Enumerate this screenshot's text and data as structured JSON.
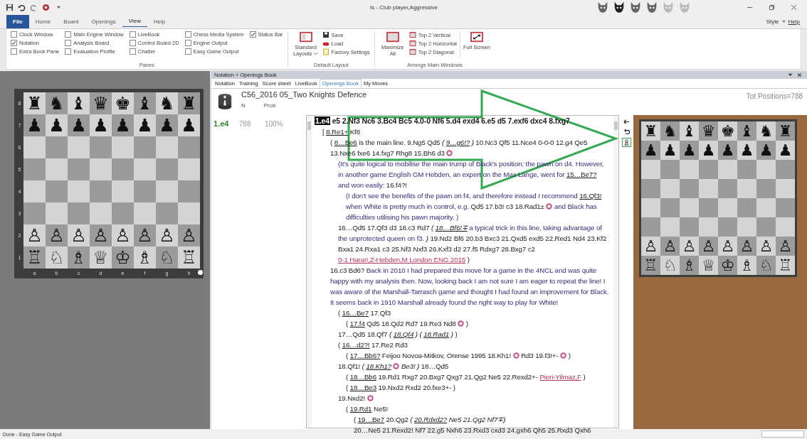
{
  "title_bar": {
    "title": "ts - Club player,Aggressive"
  },
  "ribbon": {
    "tabs": [
      {
        "label": "File",
        "kind": "file",
        "selected": false
      },
      {
        "label": "Home",
        "kind": "tab",
        "selected": false
      },
      {
        "label": "Board",
        "kind": "tab",
        "selected": false
      },
      {
        "label": "Openings",
        "kind": "tab",
        "selected": false
      },
      {
        "label": "View",
        "kind": "tab",
        "selected": true
      },
      {
        "label": "Help",
        "kind": "tab",
        "selected": false
      }
    ],
    "style_menu": "Style",
    "help_link": "Help",
    "panes": {
      "label": "Panes",
      "columns": [
        [
          {
            "label": "Clock Window",
            "checked": false
          },
          {
            "label": "Notation",
            "checked": true
          },
          {
            "label": "Extra Book Pane",
            "checked": false
          }
        ],
        [
          {
            "label": "Main Engine Window",
            "checked": false
          },
          {
            "label": "Analysis Board",
            "checked": false
          },
          {
            "label": "Evaluation Profile",
            "checked": false
          }
        ],
        [
          {
            "label": "LiveBook",
            "checked": false
          },
          {
            "label": "Control Board 2D",
            "checked": false
          },
          {
            "label": "Chatter",
            "checked": false
          }
        ],
        [
          {
            "label": "Chess Media System",
            "checked": false
          },
          {
            "label": "Engine Output",
            "checked": false
          },
          {
            "label": "Easy Game Output",
            "checked": false
          }
        ],
        [
          {
            "label": "Status Bar",
            "checked": true
          }
        ]
      ]
    },
    "default_layout": {
      "label": "Default Layout",
      "standard_layouts": "Standard Layouts",
      "save": "Save",
      "load": "Load",
      "factory_settings": "Factory Settings"
    },
    "arrange": {
      "label": "Arrange Main Windows",
      "maximize": "Maximize All",
      "options": [
        "Top 2 Vertical",
        "Top 2 Horizontal",
        "Top 2 Diagonal"
      ],
      "full_screen": "Full Screen"
    }
  },
  "left_board": {
    "ranks": [
      {
        "label": "8",
        "kind": "pieces",
        "pieces": "♜ ♞ ♝ ♛ ♚ ♝ ♞ ♜"
      },
      {
        "label": "7",
        "kind": "pieces",
        "pieces": "♟ ♟ ♟ ♟ ♟ ♟ ♟ ♟"
      },
      {
        "label": "6",
        "kind": "empty"
      },
      {
        "label": "5",
        "kind": "empty"
      },
      {
        "label": "4",
        "kind": "empty"
      },
      {
        "label": "3",
        "kind": "empty"
      },
      {
        "label": "2",
        "kind": "pieces",
        "pieces": "♙ ♙ ♙ ♙ ♙ ♙ ♙ ♙"
      },
      {
        "label": "1",
        "kind": "pieces",
        "pieces": "♖ ♘ ♗ ♕ ♔ ♗ ♘ ♖"
      }
    ],
    "files": [
      "a",
      "b",
      "c",
      "d",
      "e",
      "f",
      "g",
      "h"
    ]
  },
  "notation_pane": {
    "title": "Notation + Openings Book",
    "tabs": [
      {
        "label": "Notation",
        "selected": false
      },
      {
        "label": "Training",
        "selected": false
      },
      {
        "label": "Score sheet",
        "selected": false
      },
      {
        "label": "LiveBook",
        "selected": false
      },
      {
        "label": "Openings Book",
        "selected": true
      },
      {
        "label": "My Moves",
        "selected": false
      }
    ],
    "book": {
      "name": "C56_2016 05_Two Knights Defence",
      "columns": [
        "N",
        "Prob"
      ],
      "total": "Tot Positions=788",
      "rows": [
        {
          "move": "1.e4",
          "n": "788",
          "prob": "100%"
        }
      ]
    },
    "notation": [
      {
        "segments": [
          {
            "kind": "current",
            "text": "1.e4"
          },
          {
            "kind": "main",
            "text": "e5 2.Nf3 Nc6 3.Bc4 Bc5 4.0-0 Nf6 5.d4 exd4 6.e5 d5 7.exf6 dxc4 8.fxg7"
          }
        ],
        "children": [
          {
            "segments": [
              {
                "kind": "text",
                "text": "["
              },
              {
                "kind": "link",
                "text": "8.Re1+"
              },
              {
                "kind": "text",
                "text": "Kf8"
              }
            ],
            "children": [
              {
                "segments": [
                  {
                    "kind": "text",
                    "text": "("
                  },
                  {
                    "kind": "link",
                    "text": "8…Be6"
                  },
                  {
                    "kind": "text",
                    "text": "is the main line. 9.Ng5 Qd5"
                  },
                  {
                    "kind": "italic",
                    "text": "("
                  },
                  {
                    "kind": "italic_link",
                    "text": "9…g6!?"
                  },
                  {
                    "kind": "italic",
                    "text": ")"
                  },
                  {
                    "kind": "text",
                    "text": "10.Nc3 Qf5 11.Nce4 0-0-0 12.g4 Qe5 13.Nxe6 fxe6 14.fxg7 Rhg8 15.Bh6 d3"
                  },
                  {
                    "kind": "diagram"
                  }
                ],
                "children": [
                  {
                    "segments": [
                      {
                        "kind": "comment",
                        "text": "(It's quite logical to mobilise the main trump of Black's position: the pawn on d4. However, in another game English GM Hebden, an expert on the Max Lange, went for"
                      },
                      {
                        "kind": "link",
                        "text": "15…Be7?"
                      }
                    ]
                  },
                  {
                    "segments": [
                      {
                        "kind": "comment",
                        "text": "and won easily:"
                      },
                      {
                        "kind": "text",
                        "text": "16.f4?!"
                      }
                    ],
                    "children": [
                      {
                        "segments": [
                          {
                            "kind": "comment",
                            "text": "(I don't see the benefits of the pawn on f4, and therefore instead I recommend"
                          },
                          {
                            "kind": "link",
                            "text": "16.Qf3!"
                          },
                          {
                            "kind": "comment",
                            "text": "when White is pretty much in control, e.g."
                          },
                          {
                            "kind": "text",
                            "text": "Qd5 17.b3! c3 18.Rad1±"
                          },
                          {
                            "kind": "diagram"
                          },
                          {
                            "kind": "comment",
                            "text": "and Black has difficulties utilising his pawn majority. )"
                          }
                        ]
                      }
                    ]
                  },
                  {
                    "segments": [
                      {
                        "kind": "text",
                        "text": "16…Qd5 17.Qf3 d3 18.c3 Rd7"
                      },
                      {
                        "kind": "italic",
                        "text": "("
                      },
                      {
                        "kind": "italic_link",
                        "text": "18…Bf6!∓"
                      },
                      {
                        "kind": "comment",
                        "text": "a typical trick in this line, taking advantage of the unprotected queen on f3."
                      },
                      {
                        "kind": "italic",
                        "text": ")"
                      },
                      {
                        "kind": "text",
                        "text": "19.Nd2 Bf6 20.b3 Bxc3 21.Qxd5 exd5 22.Red1 Nd4 23.Kf2 Bxa1 24.Rxa1 c3 25.Nf3 Nxf3 26.Kxf3 d2 27.f5 Rdxg7 28.Bxg7 c2"
                      },
                      {
                        "kind": "source",
                        "text": "0-1 Harari,Z-Hebden,M London ENG 2015"
                      },
                      {
                        "kind": "text",
                        "text": ")"
                      }
                    ]
                  }
                ]
              },
              {
                "segments": [
                  {
                    "kind": "text",
                    "text": "16.c3 Bd6?"
                  },
                  {
                    "kind": "comment",
                    "text": "Back in 2010 I had prepared this move for a game in the 4NCL and was quite happy with my analysis then. Now, looking back I am not sure I am eager to repeat the line! I was aware of the Marshall-Tarrasch game and thought I had found an improvement for Black. It seems back in 1910 Marshall already found the right way to play for White!"
                  }
                ],
                "children": [
                  {
                    "segments": [
                      {
                        "kind": "text",
                        "text": "("
                      },
                      {
                        "kind": "link",
                        "text": "16…Be7"
                      },
                      {
                        "kind": "text",
                        "text": "17.Qf3"
                      }
                    ],
                    "children": [
                      {
                        "segments": [
                          {
                            "kind": "text",
                            "text": "("
                          },
                          {
                            "kind": "link",
                            "text": "17.f4"
                          },
                          {
                            "kind": "text",
                            "text": "Qd5 18.Qd2 Rd7 19.Re3 Nd8"
                          },
                          {
                            "kind": "diagram"
                          },
                          {
                            "kind": "text",
                            "text": ")"
                          }
                        ]
                      }
                    ]
                  },
                  {
                    "segments": [
                      {
                        "kind": "text",
                        "text": "17…Qd5 18.Qf7"
                      },
                      {
                        "kind": "italic",
                        "text": "("
                      },
                      {
                        "kind": "italic_link",
                        "text": "18.Qf4"
                      },
                      {
                        "kind": "italic",
                        "text": ") ("
                      },
                      {
                        "kind": "italic_link",
                        "text": "18.Rad1"
                      },
                      {
                        "kind": "italic",
                        "text": ")"
                      },
                      {
                        "kind": "text",
                        "text": ")"
                      }
                    ]
                  },
                  {
                    "segments": [
                      {
                        "kind": "text",
                        "text": "("
                      },
                      {
                        "kind": "link",
                        "text": "16…d2?!"
                      },
                      {
                        "kind": "text",
                        "text": "17.Re2 Rd3"
                      }
                    ],
                    "children": [
                      {
                        "segments": [
                          {
                            "kind": "text",
                            "text": "("
                          },
                          {
                            "kind": "link",
                            "text": "17…Bb6?"
                          },
                          {
                            "kind": "text",
                            "text": "Feijoo Novoa-Mitkov, Orense 1995 18.Kh1!"
                          },
                          {
                            "kind": "diagram"
                          },
                          {
                            "kind": "text",
                            "text": "Rd3 19.f3!+-"
                          },
                          {
                            "kind": "diagram"
                          },
                          {
                            "kind": "text",
                            "text": ")"
                          }
                        ]
                      }
                    ]
                  },
                  {
                    "segments": [
                      {
                        "kind": "text",
                        "text": "18.Qf1!"
                      },
                      {
                        "kind": "italic",
                        "text": "("
                      },
                      {
                        "kind": "italic_link",
                        "text": "18.Kh1?"
                      },
                      {
                        "kind": "diagram"
                      },
                      {
                        "kind": "italic",
                        "text": "Be3! )"
                      },
                      {
                        "kind": "text",
                        "text": "18…Qd5"
                      }
                    ],
                    "children": [
                      {
                        "segments": [
                          {
                            "kind": "text",
                            "text": "("
                          },
                          {
                            "kind": "link",
                            "text": "18…Bb6"
                          },
                          {
                            "kind": "text",
                            "text": "19.Rd1 Rxg7 20.Bxg7 Qxg7 21.Qg2 Ne5 22.Rexd2+-"
                          },
                          {
                            "kind": "source",
                            "text": "Pieri-Yilmaz,F"
                          },
                          {
                            "kind": "text",
                            "text": ")"
                          }
                        ]
                      },
                      {
                        "segments": [
                          {
                            "kind": "text",
                            "text": "("
                          },
                          {
                            "kind": "link",
                            "text": "18…Be3"
                          },
                          {
                            "kind": "text",
                            "text": "19.Nxd2 Rxd2 20.fxe3+- )"
                          }
                        ]
                      }
                    ]
                  },
                  {
                    "segments": [
                      {
                        "kind": "text",
                        "text": "19.Nxd2!"
                      },
                      {
                        "kind": "diagram"
                      }
                    ],
                    "children": [
                      {
                        "segments": [
                          {
                            "kind": "text",
                            "text": "("
                          },
                          {
                            "kind": "link",
                            "text": "19.Rd1"
                          },
                          {
                            "kind": "text",
                            "text": "Ne5!"
                          }
                        ],
                        "children": [
                          {
                            "segments": [
                              {
                                "kind": "text",
                                "text": "("
                              },
                              {
                                "kind": "link",
                                "text": "19…Be7"
                              },
                              {
                                "kind": "text",
                                "text": "20.Qg2"
                              },
                              {
                                "kind": "italic",
                                "text": "("
                              },
                              {
                                "kind": "italic_link",
                                "text": "20.Rdxd2?"
                              },
                              {
                                "kind": "italic",
                                "text": "Ne5 21.Qg2 Nf7∓)"
                              }
                            ]
                          },
                          {
                            "segments": [
                              {
                                "kind": "text",
                                "text": "20…Ne5 21.Rexd2! Nf7 22.g5 Nxh6 23.Rxd3 cxd3 24.gxh6 Qh5 25.Rxd3 Qxh6"
                              }
                            ]
                          }
                        ]
                      }
                    ]
                  }
                ]
              }
            ]
          }
        ]
      }
    ]
  },
  "right_board": {
    "ranks": [
      {
        "kind": "pieces",
        "pieces": "♜ ♞ ♝ ♛ ♚ ♝ ♞ ♜"
      },
      {
        "kind": "pieces",
        "pieces": "♟ ♟ ♟ ♟ ♟ ♟ ♟ ♟"
      },
      {
        "kind": "empty"
      },
      {
        "kind": "empty"
      },
      {
        "kind": "empty"
      },
      {
        "kind": "empty"
      },
      {
        "kind": "pieces",
        "pieces": "♙ ♙ ♙ ♙ ♙ ♙ ♙ ♙"
      },
      {
        "kind": "pieces",
        "pieces": "♖ ♘ ♗ ♕ ♔ ♗ ♘ ♖"
      }
    ]
  },
  "status_bar": {
    "text": "Done - Easy Game Output"
  }
}
